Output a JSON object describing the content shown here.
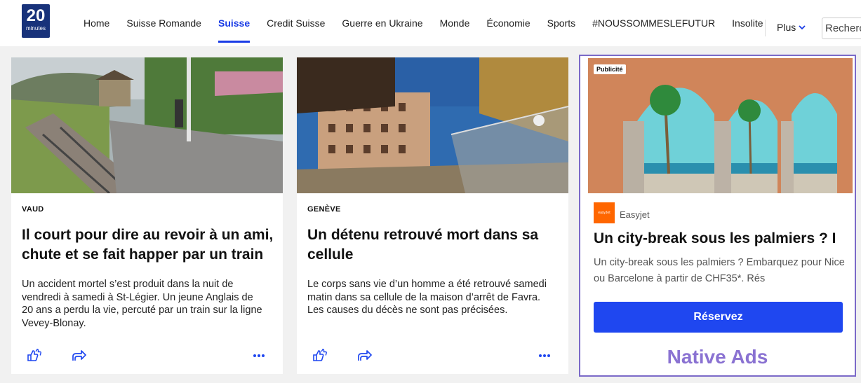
{
  "logo": {
    "number": "20",
    "word": "minutes"
  },
  "nav": {
    "items": [
      {
        "label": "Home"
      },
      {
        "label": "Suisse Romande"
      },
      {
        "label": "Suisse"
      },
      {
        "label": "Credit Suisse"
      },
      {
        "label": "Guerre en Ukraine"
      },
      {
        "label": "Monde"
      },
      {
        "label": "Économie"
      },
      {
        "label": "Sports"
      },
      {
        "label": "#NOUSSOMMESLEFUTUR"
      },
      {
        "label": "Insolite"
      }
    ],
    "active": "Suisse",
    "more_label": "Plus",
    "search_placeholder": "Rechercher"
  },
  "articles": [
    {
      "category": "VAUD",
      "title": "Il court pour dire au revoir à un ami, chute et se fait happer par un train",
      "description": "Un accident mortel s’est produit dans la nuit de vendredi à samedi à St-Légier. Un jeune Anglais de 20 ans a perdu la vie, percuté par un train sur la ligne Vevey-Blonay."
    },
    {
      "category": "GENÈVE",
      "title": "Un détenu retrouvé mort dans sa cellule",
      "description": "Le corps sans vie d’un homme a été retrouvé samedi matin dans sa cellule de la maison d’arrêt de Favra. Les causes du décès ne sont pas précisées."
    }
  ],
  "ad": {
    "badge": "Publicité",
    "logo_text": "easyJet",
    "brand": "Easyjet",
    "title": "Un city-break sous les palmiers ? I",
    "description": "Un city-break sous les palmiers ? Embarquez pour Nice ou Barcelone à partir de CHF35*. Rés",
    "cta": "Réservez",
    "native_label": "Native Ads"
  },
  "colors": {
    "accent": "#1a3ce6",
    "cta": "#1f47f0",
    "ad_border": "#7b6ac8",
    "native_label": "#8a72d2",
    "brand_orange": "#ff6600",
    "logo_bg": "#18327a"
  }
}
